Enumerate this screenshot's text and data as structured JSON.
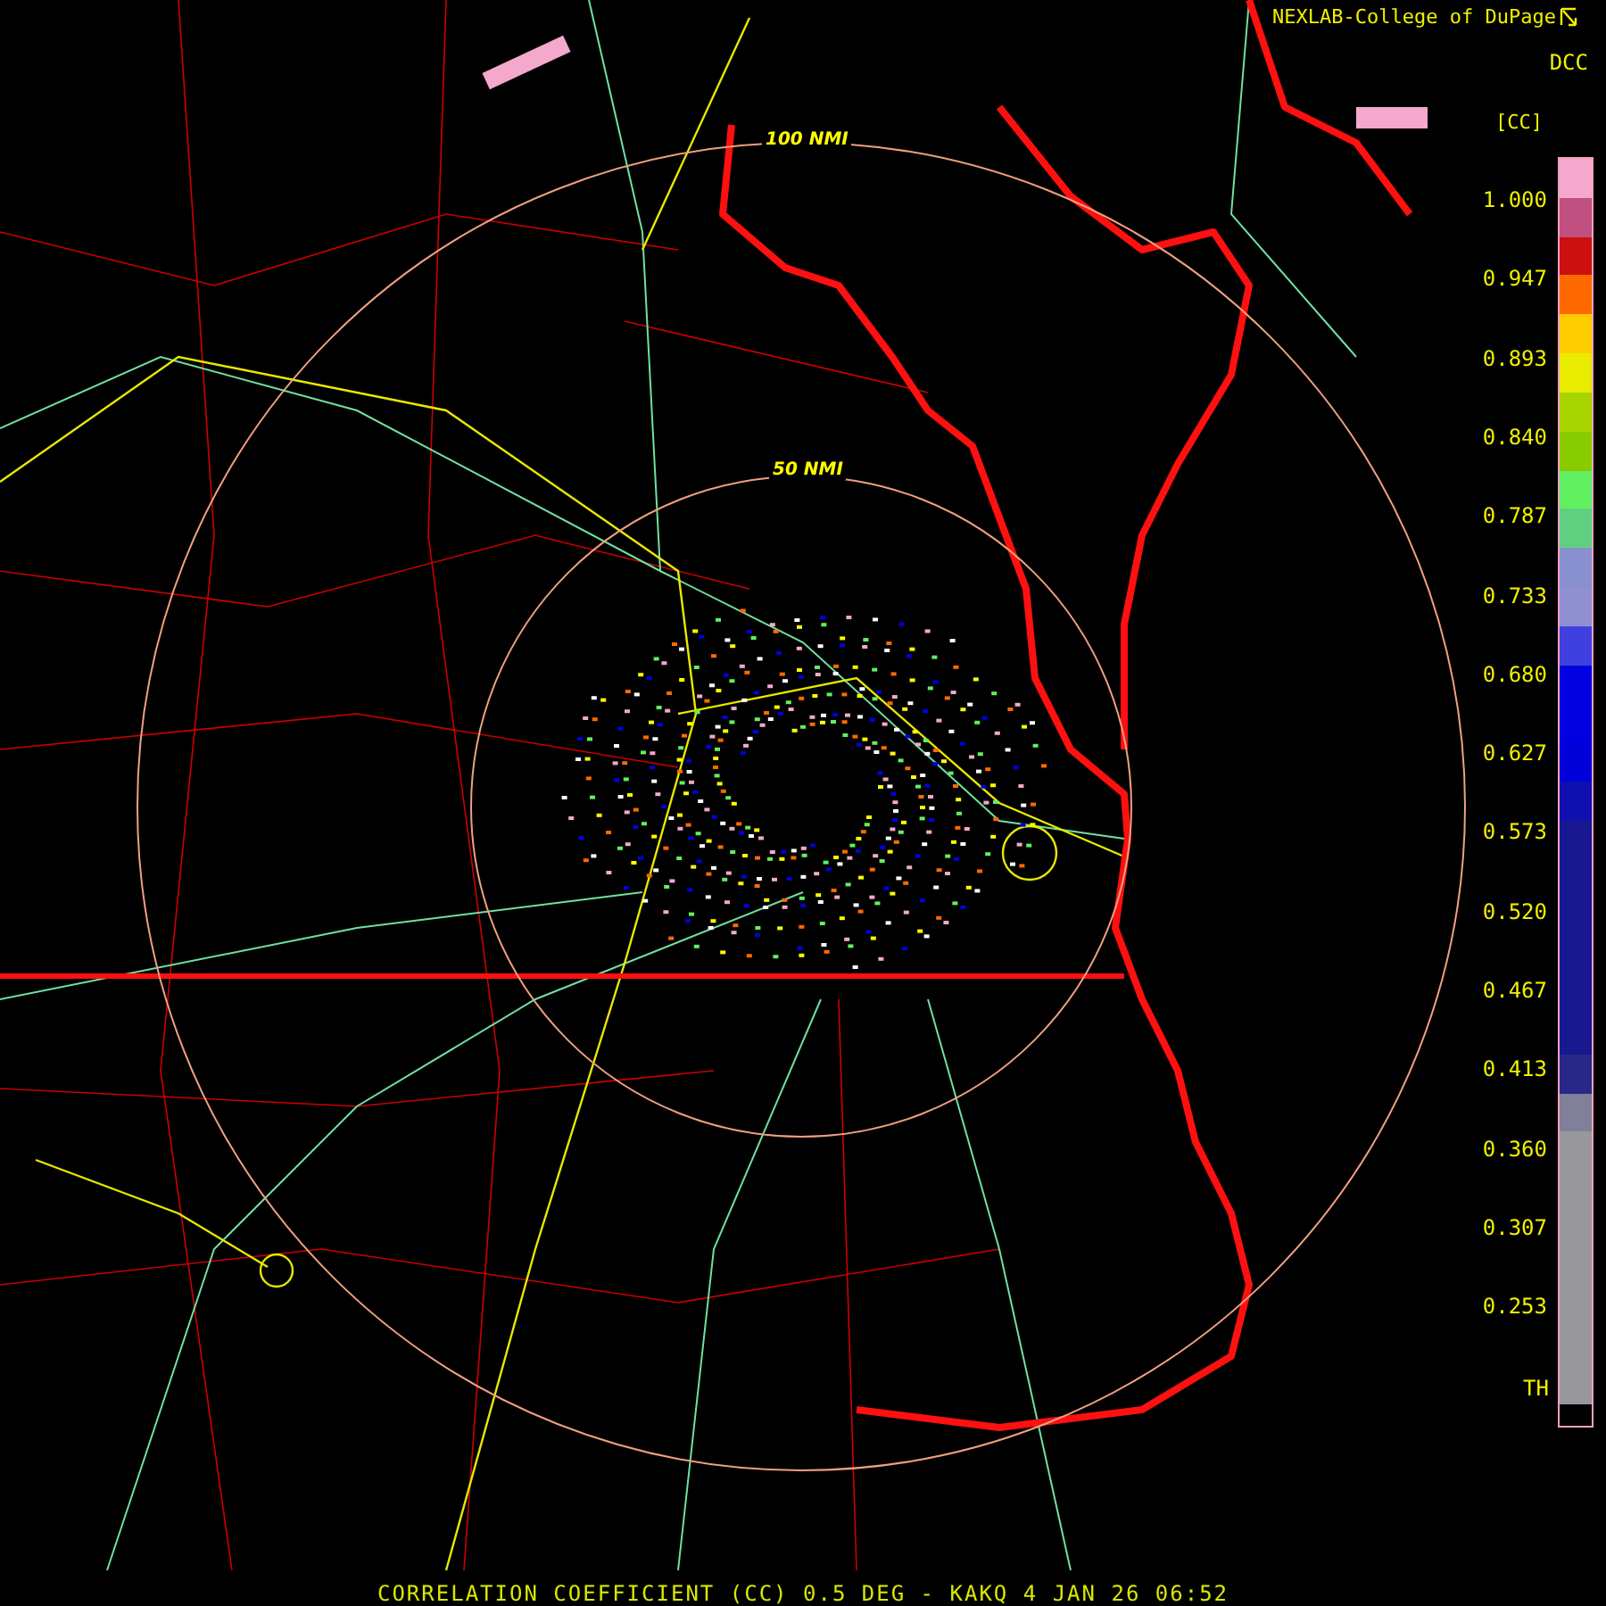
{
  "credit": "NEXLAB-College of DuPage",
  "range_rings": [
    {
      "label": "100 NMI"
    },
    {
      "label": "50 NMI"
    }
  ],
  "legend": {
    "product": "DCC",
    "unit": "[CC]",
    "ticks": [
      "1.000",
      "0.947",
      "0.893",
      "0.840",
      "0.787",
      "0.733",
      "0.680",
      "0.627",
      "0.573",
      "0.520",
      "0.467",
      "0.413",
      "0.360",
      "0.307",
      "0.253"
    ],
    "threshold_label": "TH",
    "colors": [
      {
        "color": "#f4a8cc"
      },
      {
        "color": "#c05080"
      },
      {
        "color": "#cc1010"
      },
      {
        "color": "#ff6a00"
      },
      {
        "color": "#ffcc00"
      },
      {
        "color": "#e8ec00"
      },
      {
        "color": "#a8d400"
      },
      {
        "color": "#88cc00"
      },
      {
        "color": "#60f060"
      },
      {
        "color": "#60d080"
      },
      {
        "color": "#8890d0"
      },
      {
        "color": "#9090d0"
      },
      {
        "color": "#4040e0"
      },
      {
        "color": "#0000e0"
      },
      {
        "color": "#0000e0"
      },
      {
        "color": "#0000d8"
      },
      {
        "color": "#1010b0"
      },
      {
        "color": "#181890"
      },
      {
        "color": "#181890"
      },
      {
        "color": "#181890"
      },
      {
        "color": "#181890"
      },
      {
        "color": "#181890"
      },
      {
        "color": "#181890"
      },
      {
        "color": "#282888"
      },
      {
        "color": "#808098"
      },
      {
        "color": "#98989c"
      },
      {
        "color": "#98989c"
      },
      {
        "color": "#98989c"
      },
      {
        "color": "#98989c"
      },
      {
        "color": "#98989c"
      },
      {
        "color": "#98989c"
      },
      {
        "color": "#98989c"
      }
    ]
  },
  "caption": "CORRELATION COEFFICIENT (CC) 0.5 DEG - KAKQ 4 JAN 26 06:52"
}
